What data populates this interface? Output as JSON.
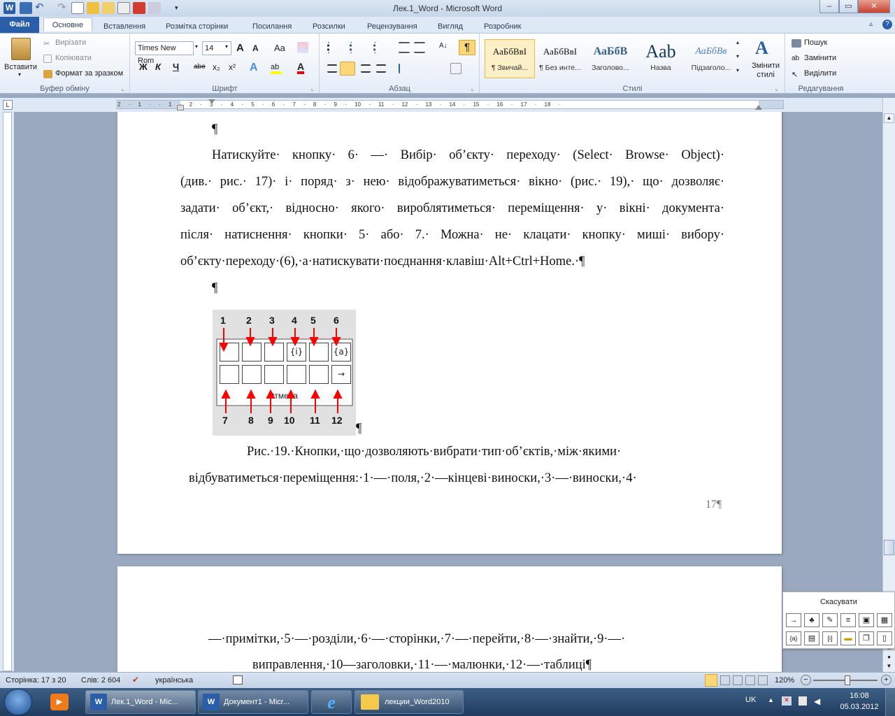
{
  "window": {
    "title": "Лек.1_Word  -  Microsoft Word",
    "minimize": "–",
    "maximize": "▭",
    "close": "✕"
  },
  "tabs": {
    "file": "Файл",
    "items": [
      "Основне",
      "Вставлення",
      "Розмітка сторінки",
      "Посилання",
      "Розсилки",
      "Рецензування",
      "Вигляд",
      "Розробник"
    ]
  },
  "clipboard": {
    "paste": "Вставити",
    "cut": "Вирізати",
    "copy": "Копіювати",
    "format_painter": "Формат за зразком",
    "label": "Буфер обміну"
  },
  "font": {
    "name": "Times New Rom",
    "size": "14",
    "bold": "Ж",
    "italic": "К",
    "underline": "Ч",
    "strike": "abe",
    "sub": "x₂",
    "sup": "x²",
    "case": "Aa",
    "grow": "A",
    "shrink": "A",
    "color_letter": "A",
    "label": "Шрифт"
  },
  "paragraph": {
    "label": "Абзац",
    "pilcrow": "¶"
  },
  "styles": {
    "label": "Стилі",
    "items": [
      {
        "preview": "АаБбВвІ",
        "name": "¶ Звичай..."
      },
      {
        "preview": "АаБбВвІ",
        "name": "¶ Без инте..."
      },
      {
        "preview": "АаБбВ",
        "name": "Заголово..."
      },
      {
        "preview": "Aab",
        "name": "Назва"
      },
      {
        "preview": "АаБбВв",
        "name": "Підзаголо..."
      }
    ],
    "change": "Змінити стилі"
  },
  "editing": {
    "find": "Пошук",
    "replace": "Замінити",
    "select": "Виділити",
    "label": "Редагування"
  },
  "ruler": {
    "nums": "2 · 1 · · 1 · 2 · 3 · 4 · 5 · 6 · 7 · 8 · 9 · 10 · 11 · 12 · 13 · 14 · 15 · 16 · 17 · 18 ·"
  },
  "doc": {
    "p_empty": "¶",
    "para1": [
      "Натискуйте· кнопку· 6· —· Вибір· об’єкту· переходу· (Select· Browse· Object)·",
      "(див.· рис.· 17)· і· поряд· з· нею· відображуватиметься· вікно· (рис.· 19),· що· дозволяє·",
      "задати· об’єкт,· відносно· якого· вироблятиметься· переміщення· у· вікні· документа·",
      "після· натиснення· кнопки· 5· або· 7.· Можна· не· клацати· кнопку· миші· вибору·"
    ],
    "para1_last": "об’єкту·переходу·(6),·а·натискувати·поєднання·клавіш·Alt+Ctrl+Home.·¶",
    "figure_after": "¶",
    "caption1": "Рис.·19.·Кнопки,·що·дозволяють·вибрати·тип·об’єктів,·між·якими·",
    "caption2": "відбуватиметься·переміщення:·1·—·поля,·2·—кінцеві·виноски,·3·—·виноски,·4·",
    "page_num": "17¶",
    "page2_line1": "—·примітки,·5·—·розділи,·6·—·сторінки,·7·—·перейти,·8·—·знайти,·9·—·",
    "page2_line2": "виправлення,·10—заголовки,·11·—·малюнки,·12·—·таблиці¶"
  },
  "figure": {
    "top_nums": [
      "1",
      "2",
      "3",
      "4",
      "5",
      "6"
    ],
    "bottom_nums": [
      "7",
      "8",
      "9",
      "10",
      "11",
      "12"
    ],
    "cancel": "Отмена",
    "top_icons": [
      "",
      "",
      "",
      "{i}",
      "",
      "{a}"
    ],
    "bottom_icons": [
      "",
      "",
      "",
      "",
      "",
      "→"
    ]
  },
  "browse_panel": {
    "title": "Скасувати"
  },
  "status": {
    "page": "Сторінка: 17 з 20",
    "words": "Слів: 2 604",
    "lang": "українська",
    "zoom": "120%"
  },
  "taskbar": {
    "items": [
      "Лек.1_Word - Mic...",
      "Документ1 - Micr...",
      "",
      "лекции_Word2010"
    ],
    "lang": "UK",
    "time": "16:08",
    "date": "05.03.2012"
  },
  "colors": {
    "accent": "#2a5ea8",
    "arrow": "#ff0000",
    "spell": "#e00000"
  }
}
